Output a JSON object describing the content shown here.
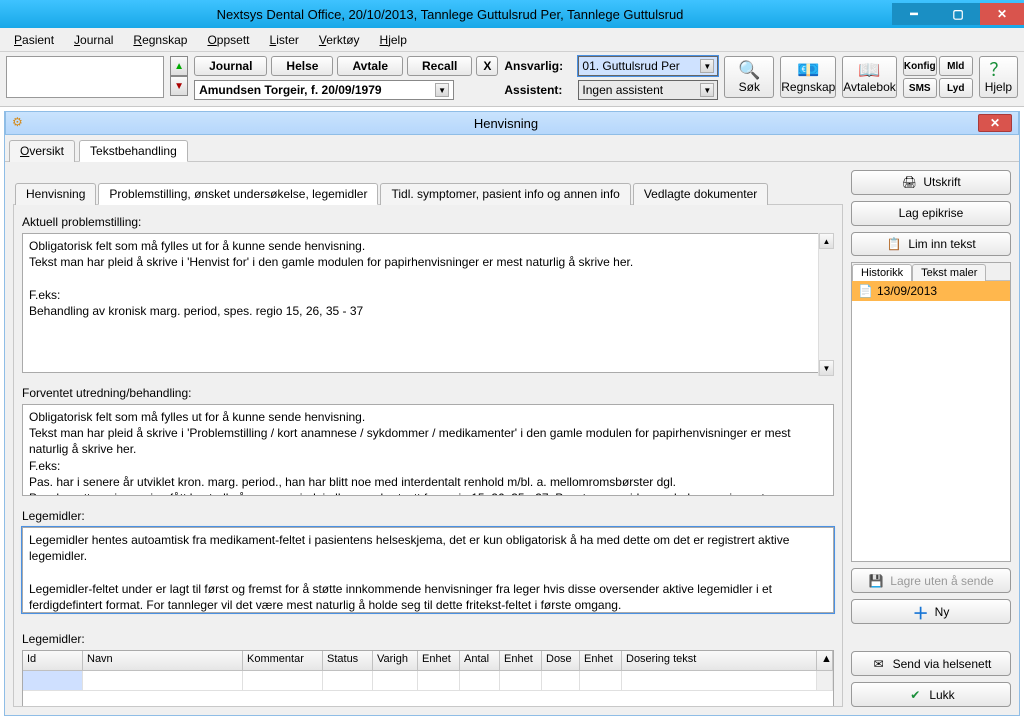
{
  "window": {
    "title": "Nextsys Dental Office,  20/10/2013, Tannlege Guttulsrud Per,  Tannlege Guttulsrud"
  },
  "menu": {
    "pasient": "Pasient",
    "journal": "Journal",
    "regnskap": "Regnskap",
    "oppsett": "Oppsett",
    "lister": "Lister",
    "verktoy": "Verktøy",
    "hjelp": "Hjelp"
  },
  "toolbar": {
    "journal": "Journal",
    "helse": "Helse",
    "avtale": "Avtale",
    "recall": "Recall",
    "x": "X",
    "patient": "Amundsen Torgeir, f. 20/09/1979",
    "ansvarlig_lbl": "Ansvarlig:",
    "ansvarlig_val": "01. Guttulsrud Per",
    "assistent_lbl": "Assistent:",
    "assistent_val": "Ingen assistent",
    "sok": "Søk",
    "regnskap": "Regnskap",
    "avtalebok": "Avtalebok",
    "konfig": "Konfig",
    "mld": "Mld",
    "sms": "SMS",
    "lyd": "Lyd",
    "hjelp": "Hjelp"
  },
  "sub": {
    "title": "Henvisning"
  },
  "tabs": {
    "oversikt": "Oversikt",
    "tekst": "Tekstbehandling"
  },
  "innerTabs": {
    "henv": "Henvisning",
    "prob": "Problemstilling, ønsket undersøkelse, legemidler",
    "tidl": "Tidl. symptomer, pasient info og annen info",
    "vedl": "Vedlagte dokumenter"
  },
  "form": {
    "aktuell_lbl": "Aktuell problemstilling:",
    "aktuell_txt": "Obligatorisk felt som må fylles ut for å kunne sende henvisning.\nTekst man har pleid å skrive i 'Henvist for' i den gamle modulen for papirhenvisninger er mest naturlig å skrive her.\n\nF.eks:\nBehandling av kronisk marg. period, spes. regio 15, 26, 35 - 37",
    "forventet_lbl": "Forventet utredning/behandling:",
    "forventet_txt": "Obligatorisk felt som må fylles ut for å kunne sende henvisning.\nTekst man har pleid å skrive i 'Problemstilling / kort anamnese / sykdommer / medikamenter' i den gamle modulen for papirhenvisninger er mest naturlig å skrive her.\nF.eks:\nPas. har i senere år utviklet kron. marg. period., han har blitt noe med interdentalt renhold m/bl. a. mellomromsbørster dgl.\nPas. har etter min mening fått kontroll på marg. period. i alle omr., bortsett fra regio 15, 26, 35 - 37. Pas. trenger viderep. -beh. spes i nevnte omr.",
    "legemidler_lbl": "Legemidler:",
    "legemidler_txt": "Legemidler hentes autoamtisk fra medikament-feltet i pasientens helseskjema, det er kun obligatorisk å ha med dette om det er registrert aktive legemidler.\n\nLegemidler-feltet under er lagt til først og fremst for å støtte innkommende henvisninger fra leger hvis disse oversender aktive legemidler i et ferdigdefintert format. For tannleger vil det være mest naturlig å holde seg til dette fritekst-feltet i første omgang.",
    "legemidler2_lbl": "Legemidler:"
  },
  "grid": {
    "cols": [
      "Id",
      "Navn",
      "Kommentar",
      "Status",
      "Varigh",
      "Enhet",
      "Antal",
      "Enhet",
      "Dose",
      "Enhet",
      "Dosering tekst"
    ]
  },
  "right": {
    "utskrift": "Utskrift",
    "lagepikrise": "Lag epikrise",
    "liminn": "Lim inn tekst",
    "historikk": "Historikk",
    "tekstmaler": "Tekst maler",
    "histdate": "13/09/2013",
    "lagre": "Lagre uten å sende",
    "ny": "Ny",
    "send": "Send via helsenett",
    "lukk": "Lukk"
  }
}
